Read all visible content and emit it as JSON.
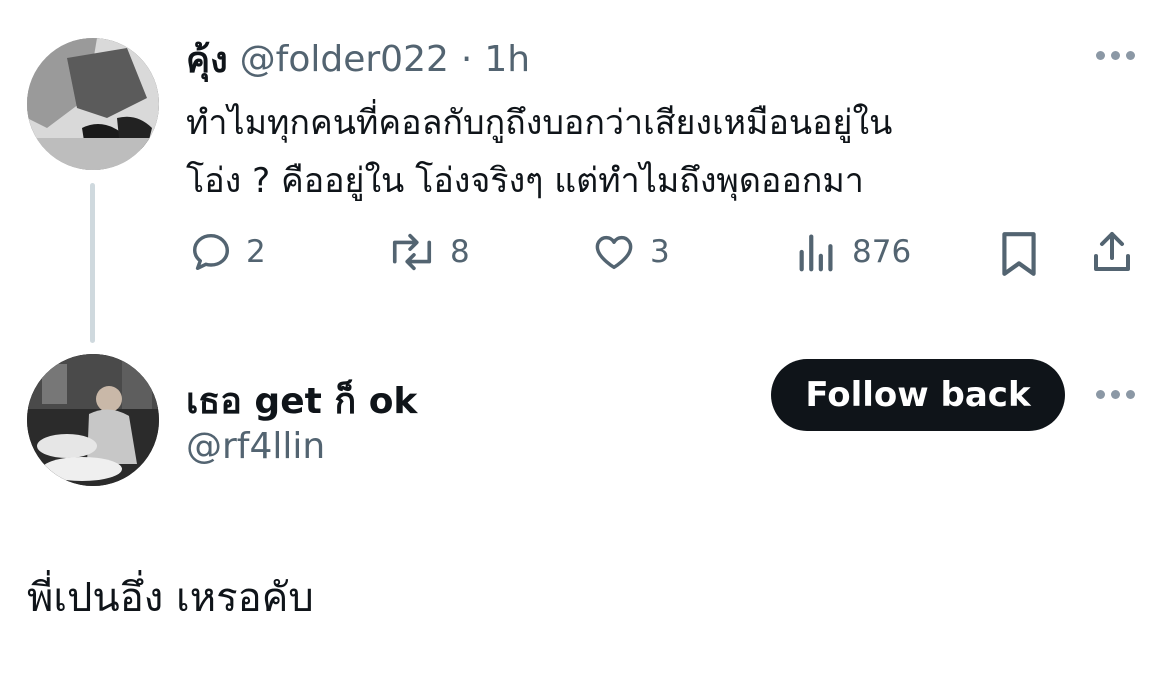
{
  "tweet": {
    "display_name": "คุ้ง",
    "handle": "@folder022",
    "separator": "·",
    "time": "1h",
    "text_line1": "ทำไมทุกคนที่คอลกับกูถึงบอกว่าเสียงเหมือนอยู่ใน",
    "text_line2": "โอ่ง ? คืออยู่ใน โอ่งจริงๆ แต่ทำไมถึงพุดออกมา",
    "actions": {
      "reply_count": "2",
      "retweet_count": "8",
      "like_count": "3",
      "view_count": "876"
    }
  },
  "reply": {
    "display_name": "เธอ get ก็ ok",
    "handle": "@rf4llin",
    "follow_button_label": "Follow back",
    "text": "พี่เปนอึ่ง เหรอคับ"
  },
  "colors": {
    "text_primary": "#0f1419",
    "text_secondary": "#536471",
    "thread_line": "#cfd9de",
    "button_bg": "#0f1419"
  },
  "icons": [
    "reply-icon",
    "retweet-icon",
    "like-icon",
    "views-icon",
    "bookmark-icon",
    "share-icon",
    "more-icon"
  ]
}
